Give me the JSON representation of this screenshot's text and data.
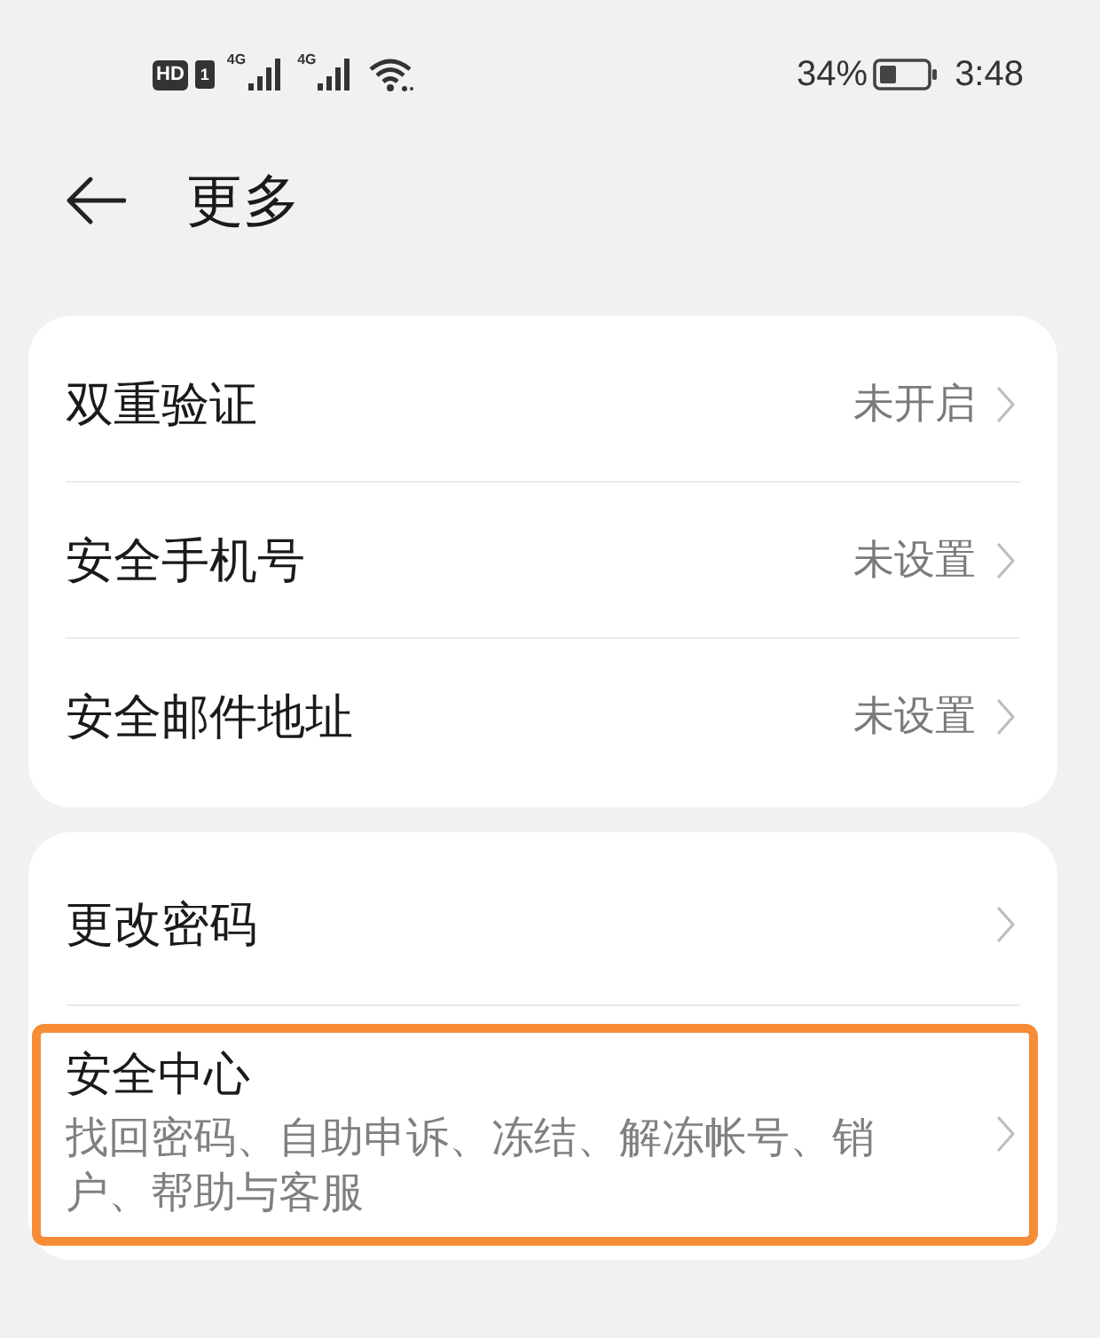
{
  "status_bar": {
    "hd": "HD",
    "sim": "1",
    "signals": [
      {
        "network": "4G"
      },
      {
        "network": "4G"
      }
    ],
    "battery_text": "34%",
    "time": "3:48"
  },
  "header": {
    "title": "更多"
  },
  "groups": [
    {
      "items": [
        {
          "kind": "value",
          "label": "双重验证",
          "value": "未开启",
          "highlighted": false
        },
        {
          "kind": "value",
          "label": "安全手机号",
          "value": "未设置",
          "highlighted": false
        },
        {
          "kind": "value",
          "label": "安全邮件地址",
          "value": "未设置",
          "highlighted": false
        }
      ]
    },
    {
      "items": [
        {
          "kind": "plain",
          "label": "更改密码",
          "highlighted": false
        },
        {
          "kind": "detail",
          "label": "安全中心",
          "subtitle": "找回密码、自助申诉、冻结、解冻帐号、销户、帮助与客服",
          "highlighted": true
        }
      ]
    }
  ]
}
